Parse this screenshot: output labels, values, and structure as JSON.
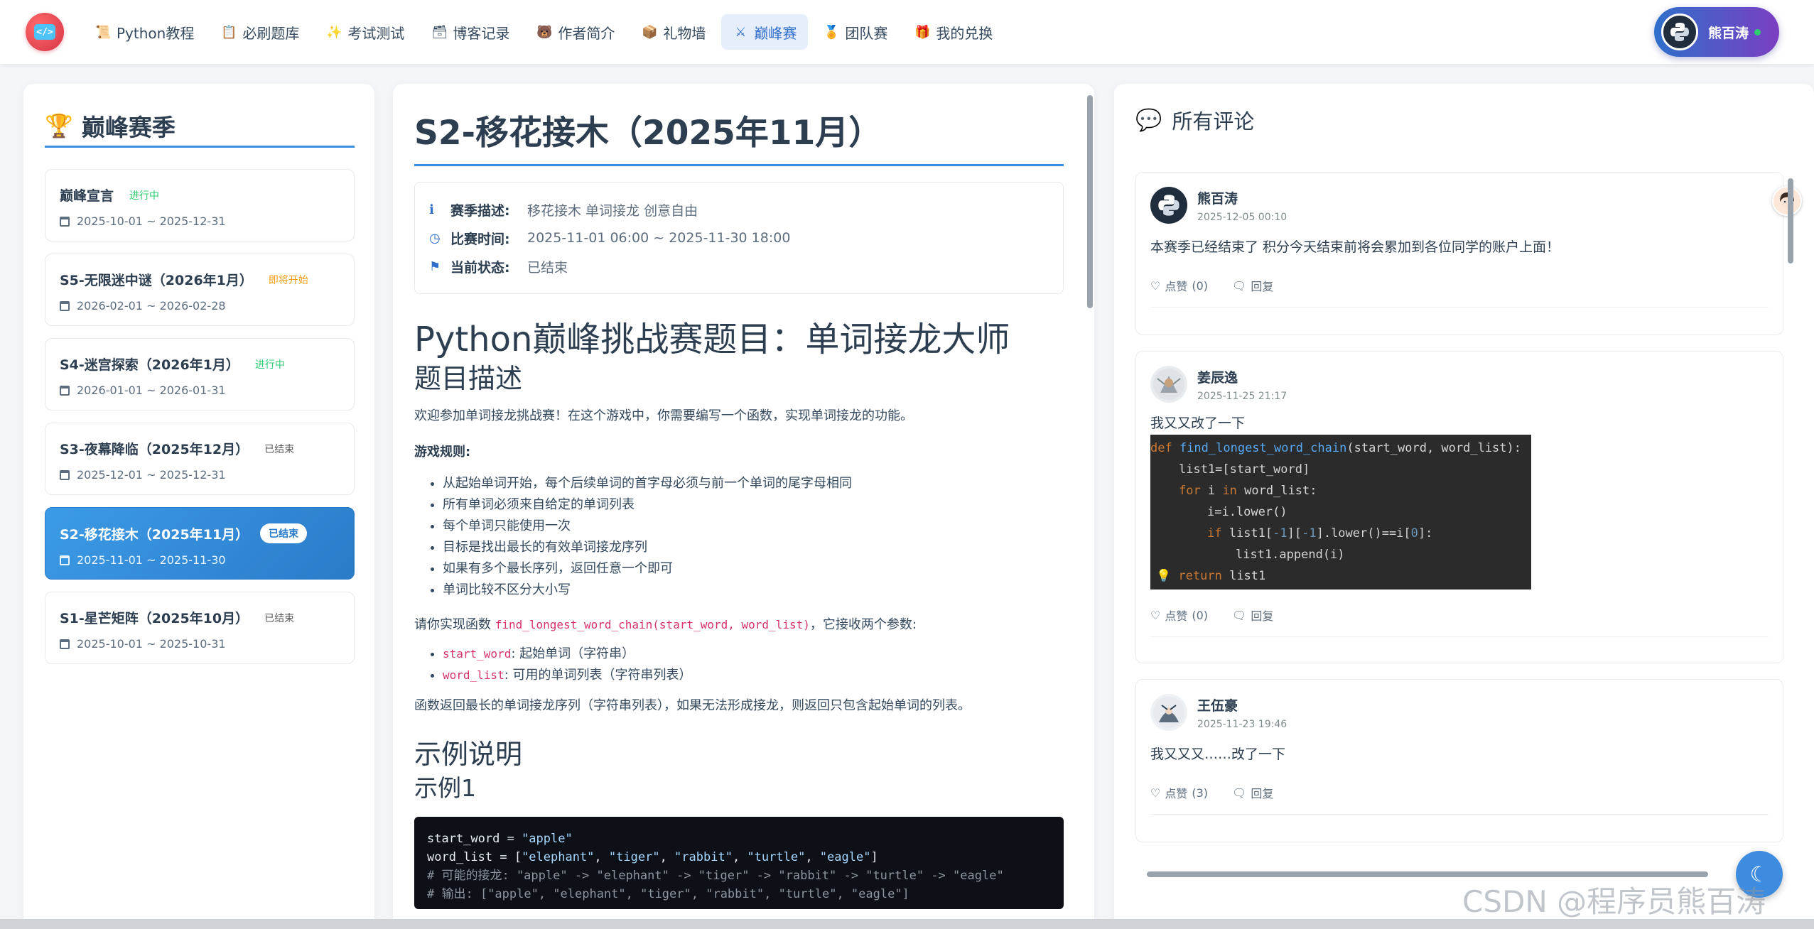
{
  "nav": {
    "logo_text": "</>",
    "items": [
      {
        "label": "Python教程",
        "icon": "📜"
      },
      {
        "label": "必刷题库",
        "icon": "📋"
      },
      {
        "label": "考试测试",
        "icon": "✨"
      },
      {
        "label": "博客记录",
        "icon": "🗃"
      },
      {
        "label": "作者简介",
        "icon": "🐻"
      },
      {
        "label": "礼物墙",
        "icon": "📦"
      },
      {
        "label": "巅峰赛",
        "icon": "⚔"
      },
      {
        "label": "团队赛",
        "icon": "🏅"
      },
      {
        "label": "我的兑换",
        "icon": "🎁"
      }
    ],
    "active": "巅峰赛",
    "user_name": "熊百涛"
  },
  "seasons": {
    "title": "巅峰赛季",
    "items": [
      {
        "name": "巅峰宣言",
        "status": "进行中",
        "date": "2025-10-01 ~ 2025-12-31"
      },
      {
        "name": "S5-无限迷中谜（2026年1月）",
        "status": "即将开始",
        "date": "2026-02-01 ~ 2026-02-28"
      },
      {
        "name": "S4-迷宫探索（2026年1月）",
        "status": "进行中",
        "date": "2026-01-01 ~ 2026-01-31"
      },
      {
        "name": "S3-夜幕降临（2025年12月）",
        "status": "已结束",
        "date": "2025-12-01 ~ 2025-12-31"
      },
      {
        "name": "S2-移花接木（2025年11月）",
        "status": "已结束",
        "date": "2025-11-01 ~ 2025-11-30"
      },
      {
        "name": "S1-星芒矩阵（2025年10月）",
        "status": "已结束",
        "date": "2025-10-01 ~ 2025-10-31"
      }
    ]
  },
  "main": {
    "title": "S2-移花接木（2025年11月）",
    "info": {
      "desc_label": "赛季描述:",
      "desc_value": "移花接木 单词接龙 创意自由",
      "time_label": "比赛时间:",
      "time_value": "2025-11-01 06:00 ~ 2025-11-30 18:00",
      "status_label": "当前状态:",
      "status_value": "已结束"
    },
    "h1": "Python巅峰挑战赛题目：单词接龙大师",
    "h2_desc": "题目描述",
    "intro": "欢迎参加单词接龙挑战赛！在这个游戏中，你需要编写一个函数，实现单词接龙的功能。",
    "rules_title": "游戏规则:",
    "rules": [
      "从起始单词开始，每个后续单词的首字母必须与前一个单词的尾字母相同",
      "所有单词必须来自给定的单词列表",
      "每个单词只能使用一次",
      "目标是找出最长的有效单词接龙序列",
      "如果有多个最长序列，返回任意一个即可",
      "单词比较不区分大小写"
    ],
    "impl_prefix": "请你实现函数 ",
    "impl_code": "find_longest_word_chain(start_word, word_list)",
    "impl_suffix": "，它接收两个参数:",
    "params": [
      {
        "code": "start_word",
        "text": ": 起始单词（字符串）"
      },
      {
        "code": "word_list",
        "text": ": 可用的单词列表（字符串列表）"
      }
    ],
    "return_text": "函数返回最长的单词接龙序列（字符串列表），如果无法形成接龙，则返回只包含起始单词的列表。",
    "h2_example": "示例说明",
    "h3_example1": "示例1",
    "code_lines": {
      "l1a": "start_word = ",
      "l1b": "\"apple\"",
      "l2a": "word_list = [",
      "l2b": "\"elephant\"",
      "l2c": ", ",
      "l2d": "\"tiger\"",
      "l2e": "\"rabbit\"",
      "l2f": "\"turtle\"",
      "l2g": "\"eagle\"",
      "l2h": "]",
      "l3": "# 可能的接龙: \"apple\" -> \"elephant\" -> \"tiger\" -> \"rabbit\" -> \"turtle\" -> \"eagle\"",
      "l4": "# 输出: [\"apple\", \"elephant\", \"tiger\", \"rabbit\", \"turtle\", \"eagle\"]"
    }
  },
  "comments": {
    "title": "所有评论",
    "like_label": "点赞",
    "reply_label": "回复",
    "items": [
      {
        "name": "熊百涛",
        "time": "2025-12-05 00:10",
        "text": "本赛季已经结束了 积分今天结束前将会累加到各位同学的账户上面！",
        "likes": "(0)"
      },
      {
        "name": "姜辰逸",
        "time": "2025-11-25 21:17",
        "text": "我又又改了一下",
        "likes": "(0)"
      },
      {
        "name": "王伍豪",
        "time": "2025-11-23 19:46",
        "text": "我又又又……改了一下",
        "likes": "(3)"
      }
    ],
    "code": {
      "l1_kw": "def ",
      "l1_fn": "find_longest_word_chain",
      "l1_rest": "(start_word, word_list):",
      "l2": "list1=[start_word]",
      "l3_kw1": "for",
      "l3_mid": " i ",
      "l3_kw2": "in",
      "l3_rest": " word_list:",
      "l4": "i=i.lower()",
      "l5_kw": "if",
      "l5_a": " list1[",
      "l5_n1": "-1",
      "l5_b": "][",
      "l5_n2": "-1",
      "l5_c": "].lower()==i[",
      "l5_n3": "0",
      "l5_d": "]:",
      "l6": "list1.append(i)",
      "l7_kw": "return",
      "l7_rest": " list1"
    }
  },
  "watermark": "CSDN @程序员熊百涛",
  "colors": {
    "accent": "#2f6fcb",
    "active_season": "#3d9be6",
    "user_chip_end": "#7b3fc2"
  }
}
